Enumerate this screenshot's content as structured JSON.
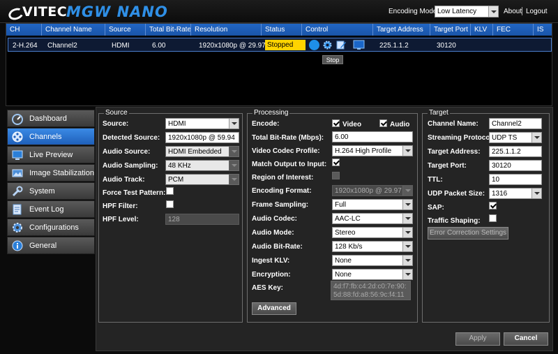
{
  "header": {
    "logo_text": "VITEC",
    "product_name": "MGW NANO",
    "encoding_mode_label": "Encoding Mode:",
    "encoding_mode_value": "Low Latency",
    "about_label": "About",
    "logout_label": "Logout"
  },
  "table": {
    "columns": [
      "CH",
      "Channel Name",
      "Source",
      "Total Bit-Rate",
      "Resolution",
      "Status",
      "Control",
      "Target Address",
      "Target Port",
      "KLV",
      "FEC",
      "IS"
    ],
    "rows": [
      {
        "ch": "2-H.264",
        "name": "Channel2",
        "source": "HDMI",
        "bitrate": "6.00",
        "resolution": "1920x1080p @ 29.97",
        "status": "Stopped",
        "target_address": "225.1.1.2",
        "target_port": "30120",
        "klv": "",
        "fec": "",
        "is": ""
      }
    ],
    "tooltip": "Stop"
  },
  "sidebar": {
    "items": [
      {
        "label": "Dashboard",
        "icon": "dashboard-icon"
      },
      {
        "label": "Channels",
        "icon": "film-reel-icon",
        "active": true
      },
      {
        "label": "Live Preview",
        "icon": "monitor-icon"
      },
      {
        "label": "Image Stabilization",
        "icon": "image-icon"
      },
      {
        "label": "System",
        "icon": "wrench-icon"
      },
      {
        "label": "Event Log",
        "icon": "log-icon"
      },
      {
        "label": "Configurations",
        "icon": "gear-icon"
      },
      {
        "label": "General",
        "icon": "info-icon"
      }
    ]
  },
  "source": {
    "title": "Source",
    "source_label": "Source:",
    "source_value": "HDMI",
    "detected_label": "Detected Source:",
    "detected_value": "1920x1080p @ 59.94",
    "audio_source_label": "Audio Source:",
    "audio_source_value": "HDMI Embedded",
    "audio_sampling_label": "Audio Sampling:",
    "audio_sampling_value": "48 KHz",
    "audio_track_label": "Audio Track:",
    "audio_track_value": "PCM",
    "force_test_label": "Force Test Pattern:",
    "hpf_filter_label": "HPF Filter:",
    "hpf_level_label": "HPF Level:",
    "hpf_level_value": "128"
  },
  "processing": {
    "title": "Processing",
    "encode_label": "Encode:",
    "video_label": "Video",
    "audio_label": "Audio",
    "total_bitrate_label": "Total Bit-Rate (Mbps):",
    "total_bitrate_value": "6.00",
    "codec_profile_label": "Video Codec Profile:",
    "codec_profile_value": "H.264 High Profile",
    "match_output_label": "Match Output to Input:",
    "roi_label": "Region of Interest:",
    "encoding_format_label": "Encoding Format:",
    "encoding_format_value": "1920x1080p @ 29.97",
    "frame_sampling_label": "Frame Sampling:",
    "frame_sampling_value": "Full",
    "audio_codec_label": "Audio Codec:",
    "audio_codec_value": "AAC-LC",
    "audio_mode_label": "Audio Mode:",
    "audio_mode_value": "Stereo",
    "audio_bitrate_label": "Audio Bit-Rate:",
    "audio_bitrate_value": "128 Kb/s",
    "ingest_klv_label": "Ingest KLV:",
    "ingest_klv_value": "None",
    "encryption_label": "Encryption:",
    "encryption_value": "None",
    "aes_key_label": "AES Key:",
    "aes_key_value": "4d:f7:fb:c4:2d:c0:7e:90:5d:88:fd:a8:56:9c:f4:11",
    "advanced_label": "Advanced"
  },
  "target": {
    "title": "Target",
    "channel_name_label": "Channel Name:",
    "channel_name_value": "Channel2",
    "protocol_label": "Streaming Protocol:",
    "protocol_value": "UDP TS",
    "address_label": "Target Address:",
    "address_value": "225.1.1.2",
    "port_label": "Target Port:",
    "port_value": "30120",
    "ttl_label": "TTL:",
    "ttl_value": "10",
    "packet_size_label": "UDP Packet Size:",
    "packet_size_value": "1316",
    "sap_label": "SAP:",
    "traffic_label": "Traffic Shaping:",
    "fec_button_label": "Error Correction Settings"
  },
  "footer": {
    "apply_label": "Apply",
    "cancel_label": "Cancel"
  },
  "colors": {
    "accent": "#2f8fe6",
    "status_stopped": "#ffd400",
    "header_blue": "#2166c4"
  }
}
